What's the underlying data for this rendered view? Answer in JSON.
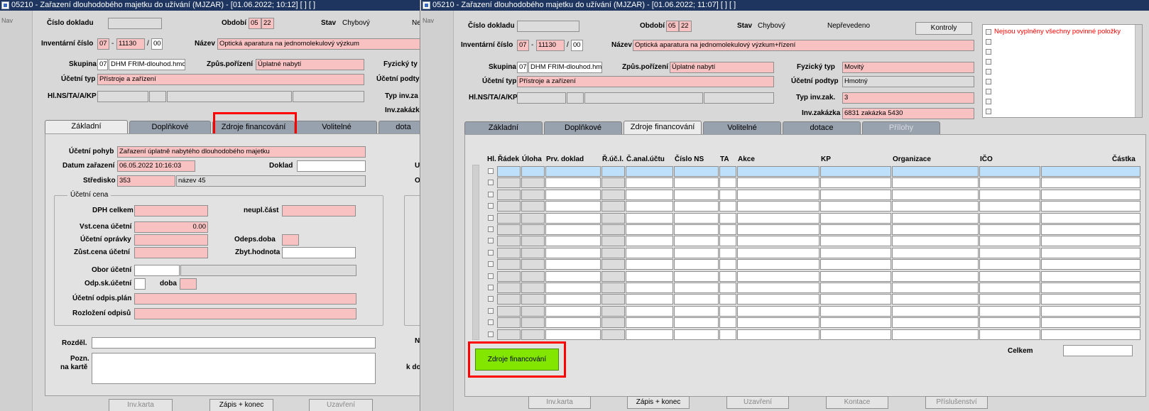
{
  "win1": {
    "title": "05210 - Zařazení dlouhodobého majetku do užívání (MJZAR) - [01.06.2022; 10:12]  [ ] [ ]",
    "nav": "Nav",
    "cislo_dokladu_label": "Číslo dokladu",
    "obdobi_label": "Období",
    "obdobi_1": "05",
    "obdobi_2": "22",
    "stav_label": "Stav",
    "stav_value": "Chybový",
    "stav_cut": "Ne",
    "inv_cislo_label": "Inventární číslo",
    "inv_1": "07",
    "inv_dash": "-",
    "inv_2": "11130",
    "inv_slash": "/",
    "inv_3": "00",
    "nazev_label": "Název",
    "nazev_value": "Optická aparatura na jednomolekulový výzkum",
    "skupina_label": "Skupina",
    "skupina_code": "07",
    "skupina_name": "DHM FRIM-dlouhod.hmo",
    "zpusob_label": "Způs.pořízení",
    "zpusob_value": "Úplatné nabytí",
    "fyz_cut": "Fyzický ty",
    "ucetni_typ_label": "Účetní typ",
    "ucetni_typ_value": "Přístroje a zařízení",
    "ucetni_podtyp_cut": "Účetní podty",
    "hlns_label": "Hl.NS/TA/A/KP",
    "typ_inv_cut": "Typ inv.za",
    "inv_zak_cut": "Inv.zakázk",
    "tabs": [
      "Základní",
      "Doplňkové",
      "Zdroje financování",
      "Volitelné",
      "dota"
    ],
    "ucetni_pohyb_label": "Účetní pohyb",
    "ucetni_pohyb_value": "Zařazení úplatně nabytého dlouhodobého majetku",
    "datum_label": "Datum zařazení",
    "datum_value": "06.05.2022 10:16:03",
    "doklad_label": "Doklad",
    "stredisko_label": "Středisko",
    "stredisko_code": "353",
    "stredisko_name": "název 45",
    "right_cut_1": "U",
    "right_cut_2": "O",
    "ucetni_cena_title": "Účetní cena",
    "dph_label": "DPH celkem",
    "neupl_label": "neupl.část",
    "vst_label": "Vst.cena účetní",
    "vst_value": "0.00",
    "opravky_label": "Účetní oprávky",
    "odeps_label": "Odeps.doba",
    "zust_label": "Zůst.cena účetní",
    "zbyt_label": "Zbyt.hodnota",
    "obor_label": "Obor účetní",
    "odp_label": "Odp.sk.účetní",
    "doba_label": "doba",
    "odpis_plan_label": "Účetní odpis.plán",
    "rozlozeni_label": "Rozložení odpisů",
    "rozdel_label": "Rozděl.",
    "pozn_label_1": "Pozn.",
    "pozn_label_2": "na kartě",
    "n_cut": "N",
    "kdo_cut": "k do",
    "buttons": [
      "Inv.karta",
      "Zápis + konec",
      "Uzavření"
    ]
  },
  "win2": {
    "title": "05210 - Zařazení dlouhodobého majetku do užívání (MJZAR) - [01.06.2022; 11:07]  [ ] [ ]",
    "nav": "Nav",
    "cislo_dokladu_label": "Číslo dokladu",
    "obdobi_label": "Období",
    "obdobi_1": "05",
    "obdobi_2": "22",
    "stav_label": "Stav",
    "stav_value": "Chybový",
    "neprevedeno": "Nepřevedeno",
    "kontroly": "Kontroly",
    "inv_cislo_label": "Inventární číslo",
    "inv_1": "07",
    "inv_dash": "-",
    "inv_2": "11130",
    "inv_slash": "/",
    "inv_3": "00",
    "nazev_label": "Název",
    "nazev_value": "Optická aparatura na jednomolekulový výzkum+řízení",
    "skupina_label": "Skupina",
    "skupina_code": "07",
    "skupina_name": "DHM FRIM-dlouhod.hmo",
    "zpusob_label": "Způs.pořízení",
    "zpusob_value": "Úplatné nabytí",
    "fyz_label": "Fyzický typ",
    "fyz_value": "Movitý",
    "ucetni_typ_label": "Účetní typ",
    "ucetni_typ_value": "Přístroje a zařízení",
    "podtyp_label": "Účetní podtyp",
    "podtyp_value": "Hmotný",
    "hlns_label": "Hl.NS/TA/A/KP",
    "typ_inv_label": "Typ inv.zak.",
    "typ_inv_value": "3",
    "inv_zak_label": "Inv.zakázka",
    "inv_zak_value": "6831 zakázka 5430",
    "error_msg": "Nejsou vyplněny všechny povinné položky",
    "tabs": [
      "Základní",
      "Doplňkové",
      "Zdroje financování",
      "Volitelné",
      "dotace",
      "Přílohy"
    ],
    "columns": [
      "Hl.",
      "Řádek",
      "Úloha",
      "Prv. doklad",
      "Ř.úč.l.",
      "Č.anal.účtu",
      "Číslo NS",
      "TA",
      "Akce",
      "KP",
      "Organizace",
      "IČO",
      "Částka"
    ],
    "zdroje_button": "Zdroje financování",
    "celkem_label": "Celkem",
    "buttons": [
      "Inv.karta",
      "Zápis + konec",
      "Uzavření",
      "Kontace",
      "Příslušenství"
    ]
  },
  "colors": {
    "titlebar": "#1d355f",
    "required_field": "#f9c2c2",
    "highlight": "#ff0000",
    "green_button": "#82e600",
    "error_text": "#ff0000"
  }
}
